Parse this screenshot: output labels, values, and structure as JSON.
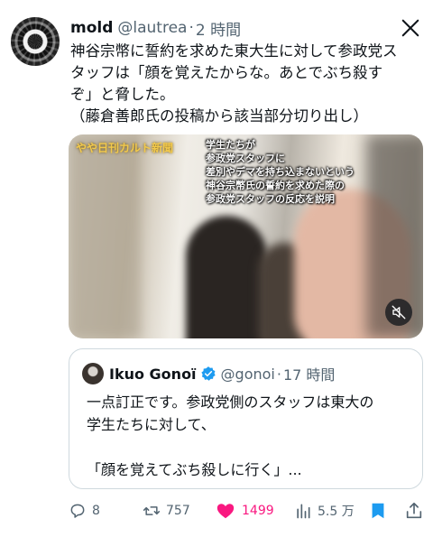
{
  "tweet": {
    "author_name": "mold",
    "author_handle": "@lautrea",
    "separator": "·",
    "time": "2 時間",
    "text_lines": [
      "神谷宗幣に誓約を求めた東大生に対して参政党ス",
      "タッフは「顔を覚えたからな。あとでぶち殺す",
      "ぞ」と脅した。",
      "（藤倉善郎氏の投稿から該当部分切り出し）"
    ]
  },
  "media": {
    "overlay_label": "やや日刊カルト新聞",
    "caption_lines": [
      "学生たちが",
      "参政党スタッフに",
      "差別やデマを持ち込まないという",
      "神谷宗幣氏の誓約を求めた際の",
      "参政党スタッフの反応を説明"
    ],
    "mute_icon": "speaker-muted-icon"
  },
  "quote": {
    "author_name": "Ikuo Gonoï",
    "author_handle": "@gonoi",
    "separator": "·",
    "time": "17 時間",
    "text_lines": [
      "一点訂正です。参政党側のスタッフは東大の",
      "学生たちに対して、",
      "",
      "「顔を覚えてぶち殺しに行く」..."
    ]
  },
  "actions": {
    "replies": "8",
    "retweets": "757",
    "likes": "1499",
    "views": "5.5 万"
  },
  "colors": {
    "text": "#0f1419",
    "secondary": "#536471",
    "like": "#f91880",
    "accent": "#1d9bf0",
    "border": "#cfd9de"
  }
}
